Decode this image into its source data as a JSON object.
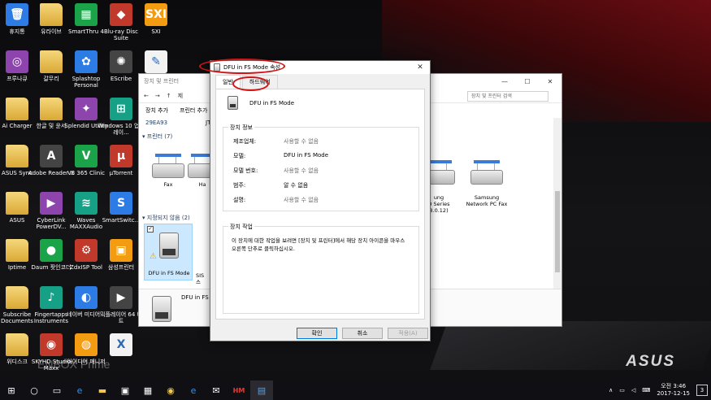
{
  "desktop_icons": [
    {
      "label": "휴지통",
      "icon": "recycle-bin-icon",
      "glyph": "🗑"
    },
    {
      "label": "유라이브",
      "icon": "folder-icon",
      "glyph": ""
    },
    {
      "label": "SmartThru 4",
      "icon": "smartthru-icon",
      "glyph": "▦"
    },
    {
      "label": "Blu-ray Disc Suite",
      "icon": "bluray-icon",
      "glyph": "◆"
    },
    {
      "label": "SXI",
      "icon": "sxi-icon",
      "glyph": "SXI"
    },
    {
      "label": "프루나큐",
      "icon": "pruna-icon",
      "glyph": "◎"
    },
    {
      "label": "갈무리",
      "icon": "folder-icon",
      "glyph": ""
    },
    {
      "label": "Splashtop Personal",
      "icon": "splashtop-icon",
      "glyph": "✿"
    },
    {
      "label": "EScribe",
      "icon": "escribe-icon",
      "glyph": "✺"
    },
    {
      "label": "",
      "icon": "document-icon",
      "glyph": "✎"
    },
    {
      "label": "Ai Charger",
      "icon": "folder-icon",
      "glyph": ""
    },
    {
      "label": "한글 및 윤서",
      "icon": "folder-icon",
      "glyph": ""
    },
    {
      "label": "Splendid Utility",
      "icon": "splendid-icon",
      "glyph": "✦"
    },
    {
      "label": "Windows 10 업그레이...",
      "icon": "windows-icon",
      "glyph": "⊞"
    },
    {
      "label": "ASUS Sync",
      "icon": "folder-icon",
      "glyph": ""
    },
    {
      "label": "Adobe Reader X",
      "icon": "adobe-reader-icon",
      "glyph": "A"
    },
    {
      "label": "V3 365 Clinic",
      "icon": "v3-icon",
      "glyph": "V"
    },
    {
      "label": "µTorrent",
      "icon": "utorrent-icon",
      "glyph": "µ"
    },
    {
      "label": "ASUS",
      "icon": "folder-icon",
      "glyph": ""
    },
    {
      "label": "CyberLink PowerDV...",
      "icon": "powerdvd-icon",
      "glyph": "▶"
    },
    {
      "label": "Waves MAXXAudio",
      "icon": "waves-icon",
      "glyph": "≋"
    },
    {
      "label": "SmartSwitc...",
      "icon": "smartswitch-icon",
      "glyph": "S"
    },
    {
      "label": "Iptime",
      "icon": "folder-icon",
      "glyph": ""
    },
    {
      "label": "Daum 팟인코더",
      "icon": "daum-icon",
      "glyph": "●"
    },
    {
      "label": "ZdxISP Tool",
      "icon": "zdx-icon",
      "glyph": "⚙"
    },
    {
      "label": "삼성프린터",
      "icon": "samsung-printer-icon",
      "glyph": "▣"
    },
    {
      "label": "Subscribe Documents",
      "icon": "folder-icon",
      "glyph": ""
    },
    {
      "label": "Fingertapps Instruments",
      "icon": "fingertapps-icon",
      "glyph": "♪"
    },
    {
      "label": "네이버 미디어...",
      "icon": "naver-media-icon",
      "glyph": "◐"
    },
    {
      "label": "믹플레이어 64 비트",
      "icon": "player-icon",
      "glyph": "▶"
    },
    {
      "label": "위디스크",
      "icon": "folder-icon",
      "glyph": ""
    },
    {
      "label": "SKYHD Studio Maxx",
      "icon": "skyhd-icon",
      "glyph": "◉"
    },
    {
      "label": "아이디어 매니저",
      "icon": "idea-icon",
      "glyph": "◍"
    },
    {
      "label": "",
      "icon": "excel-file-icon",
      "glyph": "X"
    }
  ],
  "watermark": "ENBOX Prime",
  "brand_logo": "ASUS",
  "explorer": {
    "title": "장치 및 프린터",
    "address_crumb": "제",
    "search_placeholder": "장치 및 프린터 검색",
    "commands": [
      "장치 추가",
      "프린터 추가"
    ],
    "truncated_cmd": "JT",
    "item_top": "29EA93",
    "section_printers": "프린터 (7)",
    "section_unspecified": "지정되지 않음 (2)",
    "printers": [
      {
        "label": "Fax"
      },
      {
        "label": "Ha"
      },
      {
        "label": "ung\nD Series\n8.0.12)"
      },
      {
        "label": "Samsung\nNetwork PC Fax"
      }
    ],
    "unspecified": [
      {
        "label": "DFU in FS Mode"
      },
      {
        "label": "SIS\n스"
      }
    ],
    "bottom_label": "DFU in FS"
  },
  "dialog": {
    "title": "DFU in FS Mode 속성",
    "tabs": [
      "일반",
      "하드웨어"
    ],
    "device_name": "DFU in FS Mode",
    "info_group_title": "장치 정보",
    "info_rows": [
      {
        "key": "제조업체:",
        "value": "사용할 수 없음",
        "muted": true
      },
      {
        "key": "모델:",
        "value": "DFU in FS Mode",
        "muted": false
      },
      {
        "key": "모델 번호:",
        "value": "사용할 수 없음",
        "muted": true
      },
      {
        "key": "범주:",
        "value": "알 수 없음",
        "muted": false
      },
      {
        "key": "설명:",
        "value": "사용할 수 없음",
        "muted": true
      }
    ],
    "task_group_title": "장치 작업",
    "task_text": "이 장치에 대한 작업을 보려면 [장치 및 프린터]에서 해당 장치 아이콘을 마우스 오른쪽 단추로 클릭하십시오.",
    "buttons": {
      "ok": "확인",
      "cancel": "취소",
      "apply": "적용(A)"
    }
  },
  "taskbar": {
    "items": [
      "start-icon",
      "search-icon",
      "task-view-icon",
      "edge-icon",
      "explorer-icon",
      "store-icon",
      "calculator-icon",
      "chrome-icon",
      "ie-icon",
      "mail-icon",
      "hm-icon",
      "remote-icon"
    ],
    "item_text": {
      "hm": "HM"
    },
    "time": "오전 3:46",
    "date": "2017-12-15",
    "notification_count": "3"
  }
}
